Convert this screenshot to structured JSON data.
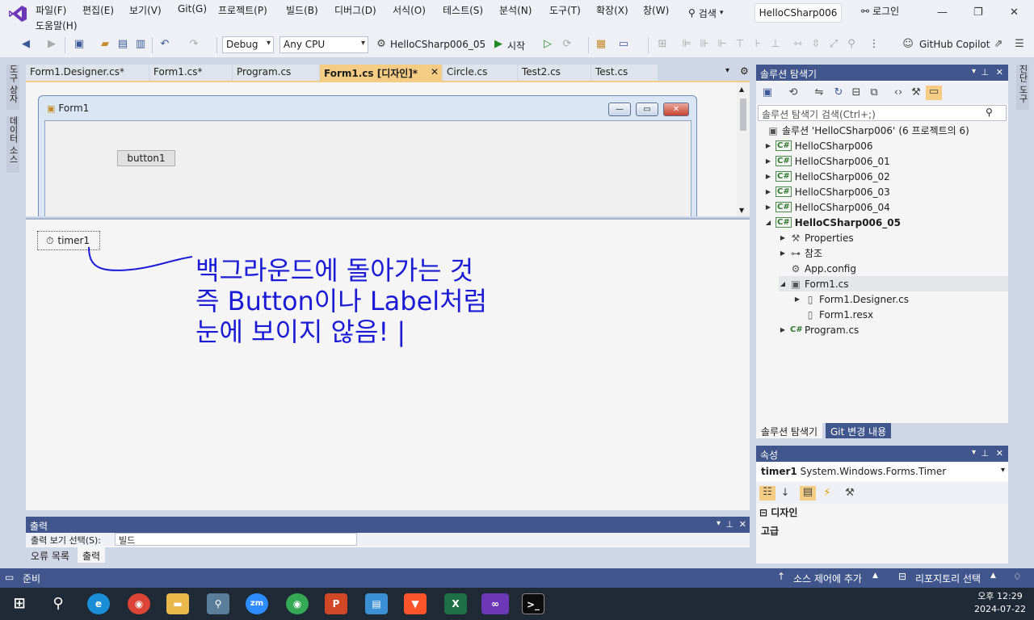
{
  "menu": {
    "items": [
      "파일(F)",
      "편집(E)",
      "보기(V)",
      "Git(G)",
      "프로젝트(P)",
      "빌드(B)",
      "디버그(D)",
      "서식(O)",
      "테스트(S)",
      "분석(N)",
      "도구(T)",
      "확장(X)",
      "창(W)"
    ],
    "help": "도움말(H)",
    "search": "검색",
    "title": "HelloCSharp006",
    "login": "로그인"
  },
  "toolbar": {
    "config": "Debug",
    "platform": "Any CPU",
    "startup_project": "HelloCSharp006_05",
    "start": "시작",
    "copilot": "GitHub Copilot"
  },
  "left_strip": {
    "toolbox": "도구 상자",
    "datasources": "데이터 소스"
  },
  "right_strip": {
    "diagnostics": "진단 도구"
  },
  "doc_tabs": [
    "Form1.Designer.cs*",
    "Form1.cs*",
    "Program.cs",
    "Form1.cs [디자인]*",
    "Circle.cs",
    "Test2.cs",
    "Test.cs"
  ],
  "designer": {
    "form_title": "Form1",
    "button_label": "button1",
    "timer_label": "timer1"
  },
  "annotation": {
    "line1": "백그라운드에 돌아가는 것",
    "line2": "즉 Button이나 Label처럼",
    "line3": "눈에 보이지 않음! |"
  },
  "output": {
    "title": "출력",
    "source_label": "출력 보기 선택(S):",
    "source_value": "빌드",
    "tabs": [
      "오류 목록",
      "출력"
    ]
  },
  "solution_explorer": {
    "title": "솔루션 탐색기",
    "search_placeholder": "솔루션 탐색기 검색(Ctrl+;)",
    "solution": "솔루션 'HelloCSharp006'",
    "solution_count": "(6 프로젝트의 6)",
    "projects": [
      "HelloCSharp006",
      "HelloCSharp006_01",
      "HelloCSharp006_02",
      "HelloCSharp006_03",
      "HelloCSharp006_04",
      "HelloCSharp006_05"
    ],
    "children": [
      "Properties",
      "참조",
      "App.config",
      "Form1.cs",
      "Form1.Designer.cs",
      "Form1.resx",
      "Program.cs"
    ],
    "bottom_tabs": [
      "솔루션 탐색기",
      "Git 변경 내용"
    ]
  },
  "properties": {
    "title": "속성",
    "object_name": "timer1",
    "object_type": "System.Windows.Forms.Timer",
    "categories": [
      "디자인",
      "고급"
    ]
  },
  "statusbar": {
    "ready": "준비",
    "source_control": "소스 제어에 추가",
    "repository": "리포지토리 선택"
  },
  "taskbar": {
    "time": "오후 12:29",
    "date": "2024-07-22"
  },
  "colors": {
    "accent": "#40568d",
    "active_tab": "#f5cc84",
    "annotation": "#1b1bd6"
  }
}
